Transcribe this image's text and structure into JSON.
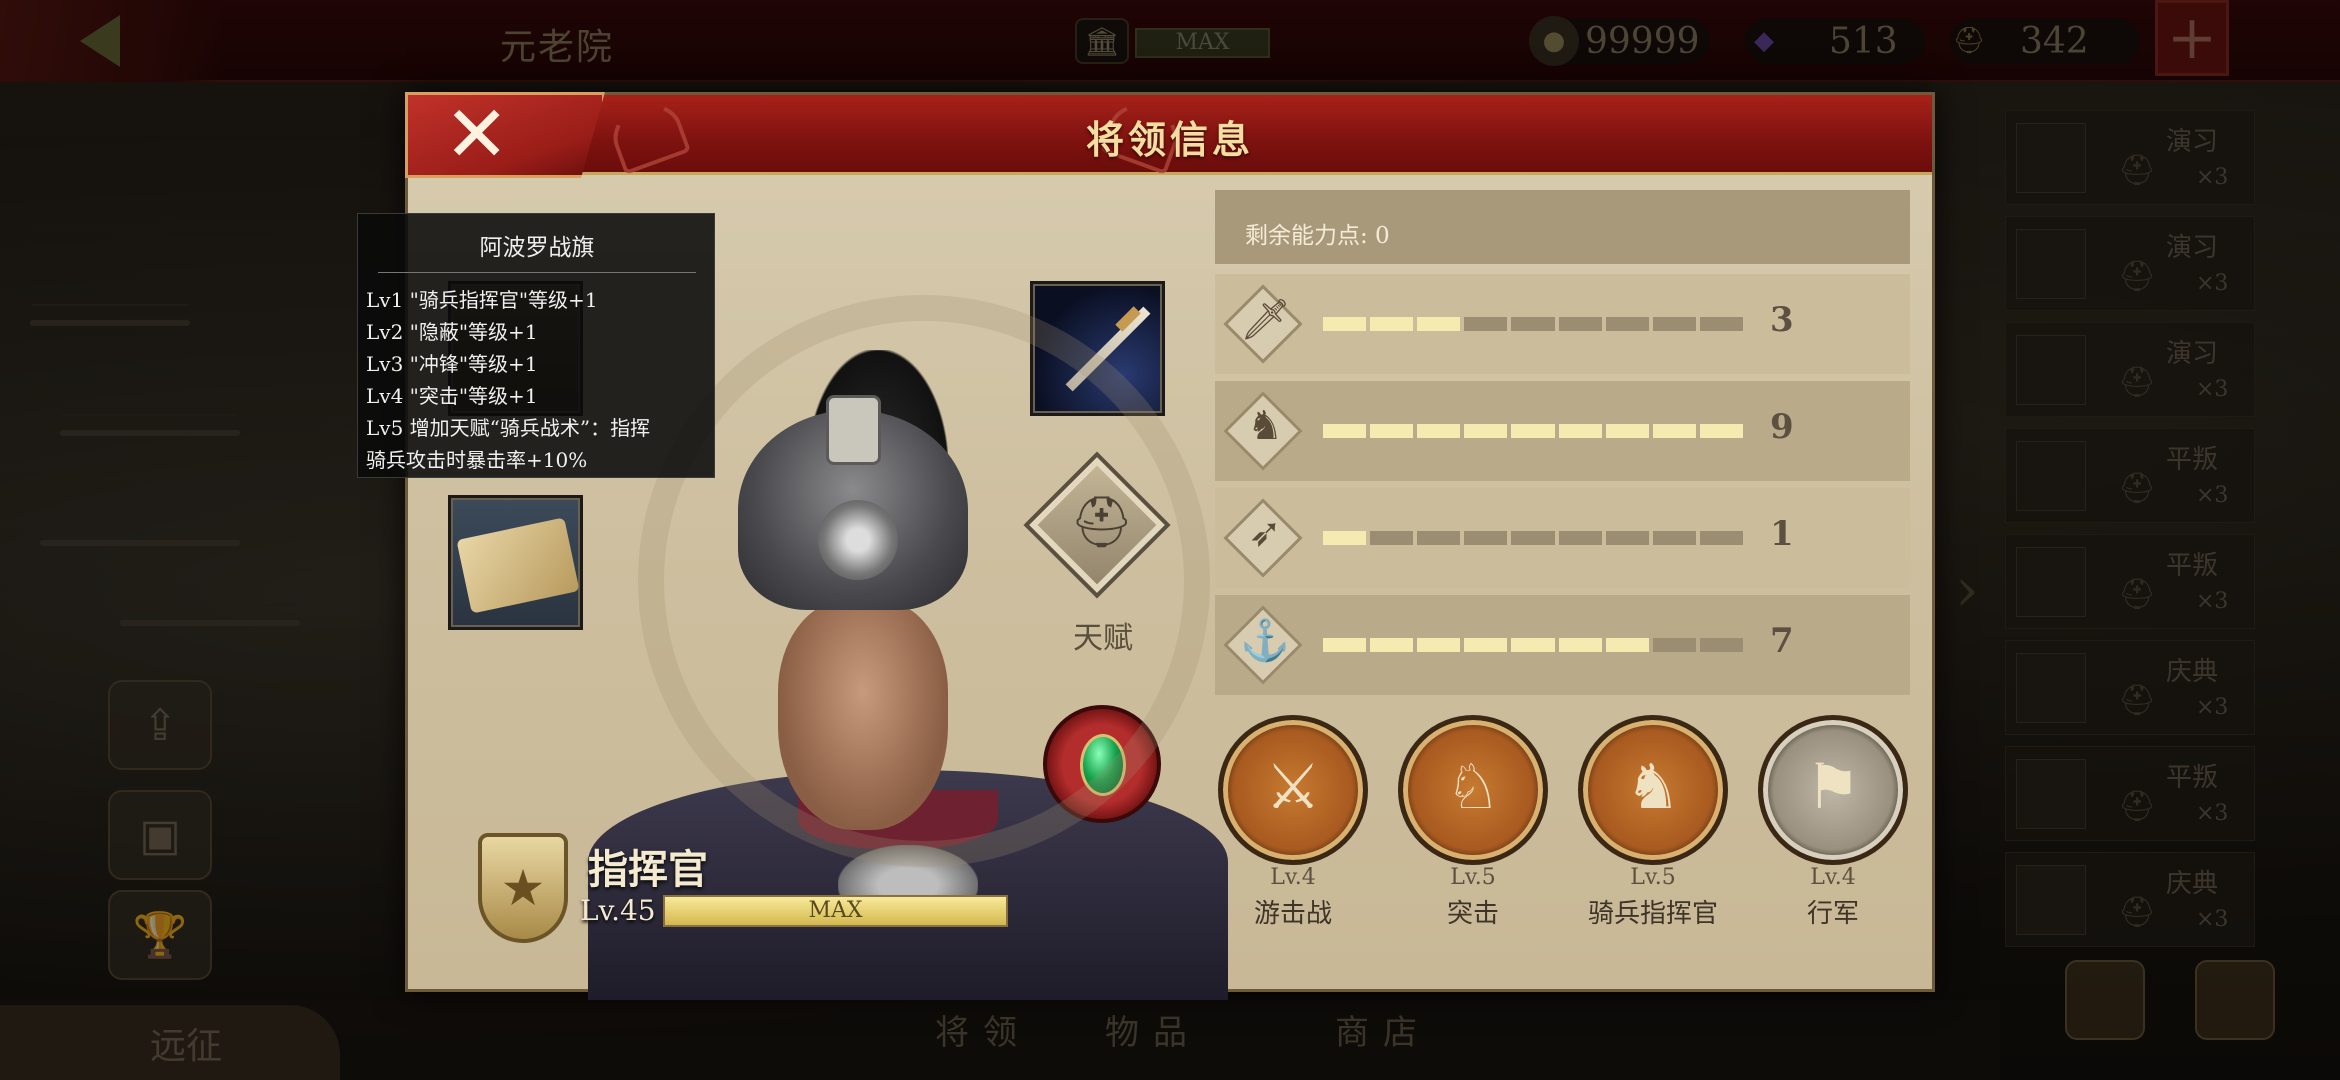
{
  "topbar": {
    "page_title": "元老院",
    "senate_level": "MAX",
    "gold": "99999",
    "gems": "513",
    "troops": "342",
    "plus_label": "+"
  },
  "modal": {
    "title": "将领信息",
    "close_label": "✕"
  },
  "tooltip": {
    "title": "阿波罗战旗",
    "lines": [
      "Lv1 \"骑兵指挥官\"等级+1",
      "Lv2 \"隐蔽\"等级+1",
      "Lv3 \"冲锋\"等级+1",
      "Lv4 \"突击\"等级+1",
      "Lv5 增加天赋“骑兵战术”：指挥",
      "骑兵攻击时暴击率+10%"
    ]
  },
  "talent": {
    "label": "天赋"
  },
  "commander": {
    "title": "指挥官",
    "level": "Lv.45",
    "xp_text": "MAX",
    "xp_fraction": 1.0
  },
  "stats": {
    "remaining_points": "剩余能力点: 0",
    "rows": [
      {
        "icon": "sword-icon",
        "value": "3",
        "filled": 3
      },
      {
        "icon": "horse-icon",
        "value": "9",
        "filled": 9
      },
      {
        "icon": "bow-icon",
        "value": "1",
        "filled": 1
      },
      {
        "icon": "anchor-icon",
        "value": "7",
        "filled": 7
      }
    ],
    "segments": 9
  },
  "skills": [
    {
      "level": "Lv.4",
      "name": "游击战",
      "style": "orange"
    },
    {
      "level": "Lv.5",
      "name": "突击",
      "style": "orange"
    },
    {
      "level": "Lv.5",
      "name": "骑兵指挥官",
      "style": "orange"
    },
    {
      "level": "Lv.4",
      "name": "行军",
      "style": "gray"
    }
  ],
  "rail": [
    {
      "label": "演习",
      "count": "×3"
    },
    {
      "label": "演习",
      "count": "×3"
    },
    {
      "label": "演习",
      "count": "×3"
    },
    {
      "label": "平叛",
      "count": "×3"
    },
    {
      "label": "平叛",
      "count": "×3"
    },
    {
      "label": "庆典",
      "count": "×3"
    },
    {
      "label": "平叛",
      "count": "×3"
    },
    {
      "label": "庆典",
      "count": "×3"
    }
  ],
  "bottom": {
    "expedition": "远征",
    "tabs": [
      "将领",
      "物品",
      "商店"
    ]
  },
  "colors": {
    "header_red": "#8e1712",
    "gold_text": "#f3dda0",
    "bar_on": "#f5eab0"
  }
}
